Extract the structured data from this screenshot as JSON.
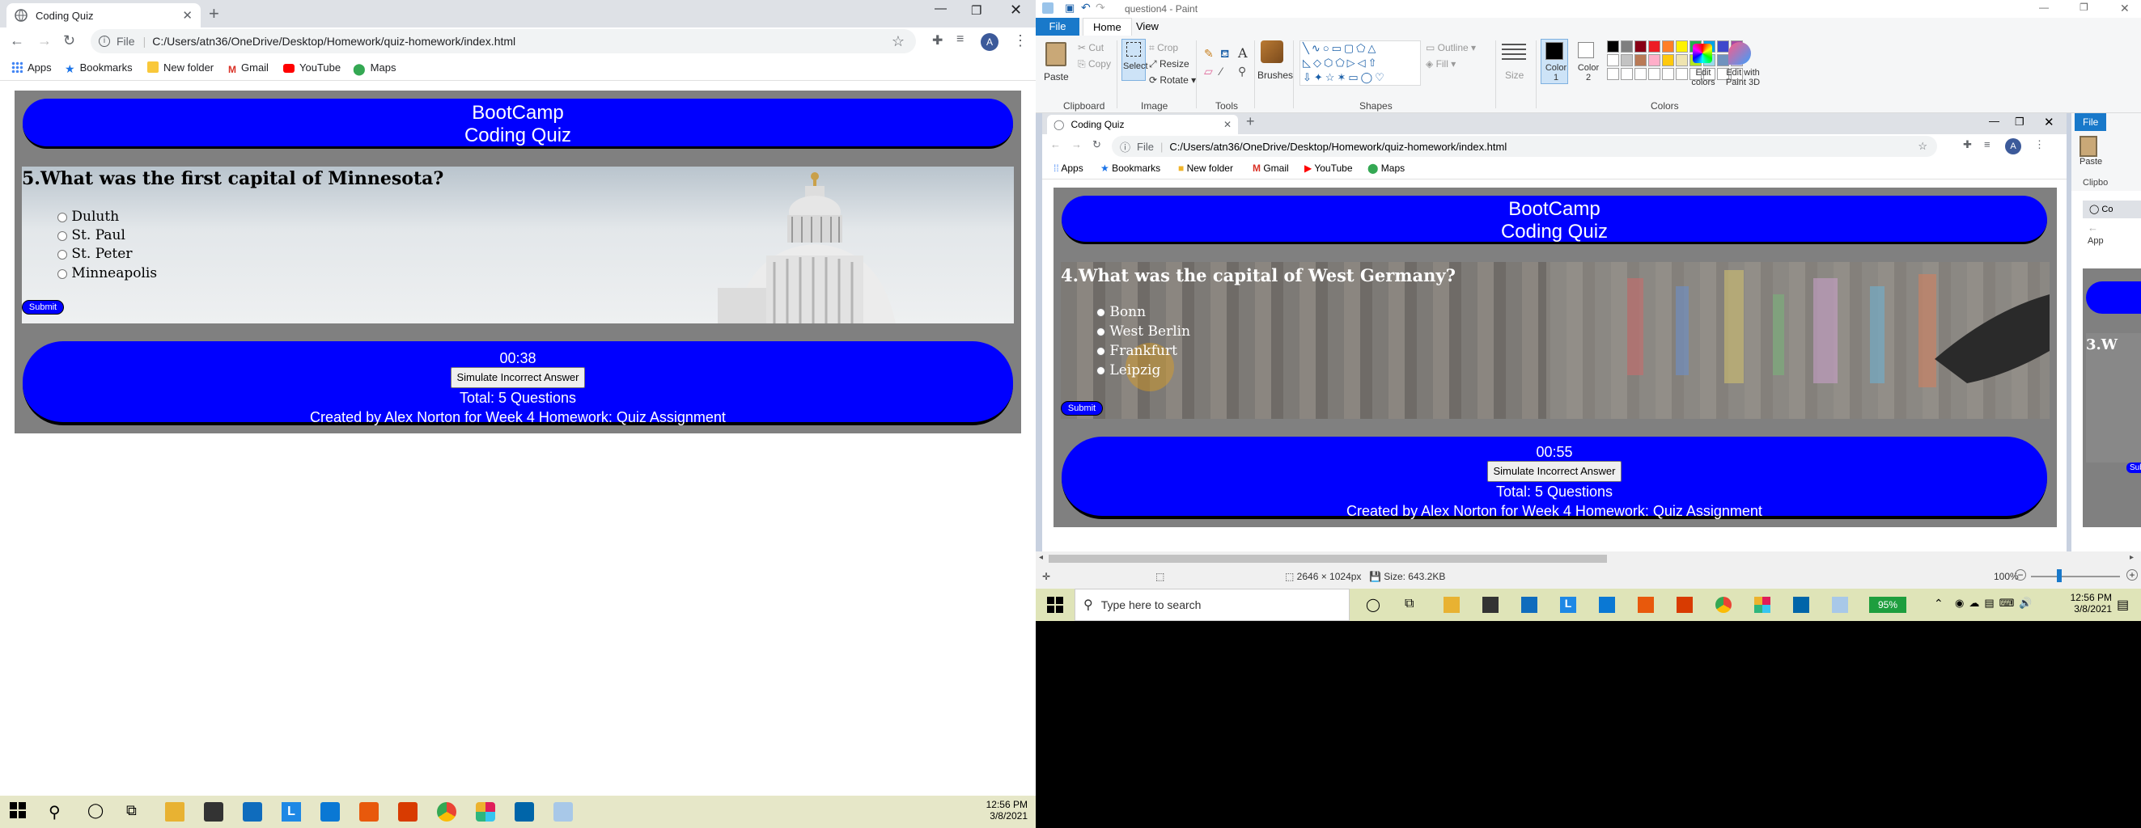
{
  "left_browser": {
    "tab_title": "Coding Quiz",
    "url_scheme": "File",
    "url": "C:/Users/atn36/OneDrive/Desktop/Homework/quiz-homework/index.html",
    "bookmarks": [
      "Apps",
      "Bookmarks",
      "New folder",
      "Gmail",
      "YouTube",
      "Maps"
    ],
    "avatar": "A"
  },
  "quiz_left": {
    "header_line1": "BootCamp",
    "header_line2": "Coding Quiz",
    "question": "5.What was the first capital of Minnesota?",
    "options": [
      "Duluth",
      "St. Paul",
      "St. Peter",
      "Minneapolis"
    ],
    "submit": "Submit",
    "timer": "00:38",
    "simulate_button": "Simulate Incorrect Answer",
    "total": "Total: 5 Questions",
    "credit": "Created by Alex Norton for Week 4 Homework: Quiz Assignment"
  },
  "left_taskbar": {
    "time": "12:56 PM",
    "date": "3/8/2021"
  },
  "paint": {
    "title": "question4 - Paint",
    "menu": [
      "File",
      "Home",
      "View"
    ],
    "clipboard": {
      "paste": "Paste",
      "cut": "Cut",
      "copy": "Copy",
      "group": "Clipboard"
    },
    "image": {
      "select": "Select",
      "crop": "Crop",
      "resize": "Resize",
      "rotate": "Rotate",
      "group": "Image"
    },
    "tools_group": "Tools",
    "brushes": "Brushes",
    "shapes": {
      "outline": "Outline",
      "fill": "Fill",
      "group": "Shapes"
    },
    "size": "Size",
    "color1": "Color 1",
    "color2": "Color 2",
    "colors_group": "Colors",
    "edit_colors": "Edit colors",
    "edit_paint3d": "Edit with Paint 3D",
    "palette": [
      "#000000",
      "#7f7f7f",
      "#880015",
      "#ed1c24",
      "#ff7f27",
      "#fff200",
      "#22b14c",
      "#00a2e8",
      "#3f48cc",
      "#a349a4",
      "#ffffff",
      "#c3c3c3",
      "#b97a57",
      "#ffaec9",
      "#ffc90e",
      "#efe4b0",
      "#b5e61d",
      "#99d9ea",
      "#7092be",
      "#c8bfe7"
    ],
    "status_dims": "2646 × 1024px",
    "status_size": "Size: 643.2KB",
    "zoom": "100%"
  },
  "quiz_right": {
    "tab_title": "Coding Quiz",
    "url_scheme": "File",
    "url": "C:/Users/atn36/OneDrive/Desktop/Homework/quiz-homework/index.html",
    "bookmarks": [
      "Apps",
      "Bookmarks",
      "New folder",
      "Gmail",
      "YouTube",
      "Maps"
    ],
    "avatar": "A",
    "header_line1": "BootCamp",
    "header_line2": "Coding Quiz",
    "question": "4.What was the capital of West Germany?",
    "options": [
      "Bonn",
      "West Berlin",
      "Frankfurt",
      "Leipzig"
    ],
    "submit": "Submit",
    "timer": "00:55",
    "simulate_button": "Simulate Incorrect Answer",
    "total": "Total: 5 Questions",
    "credit": "Created by Alex Norton for Week 4 Homework: Quiz Assignment",
    "partial_question": "3.W",
    "partial_submit": "Sub",
    "partial_tab": "Co",
    "partial_clipboard": "Clipbo",
    "partial_paste": "Paste",
    "partial_file": "File",
    "partial_bookmark": "App"
  },
  "inner_taskbar": {
    "search_placeholder": "Type here to search",
    "battery": "95%",
    "time": "12:56 PM",
    "date": "3/8/2021"
  }
}
